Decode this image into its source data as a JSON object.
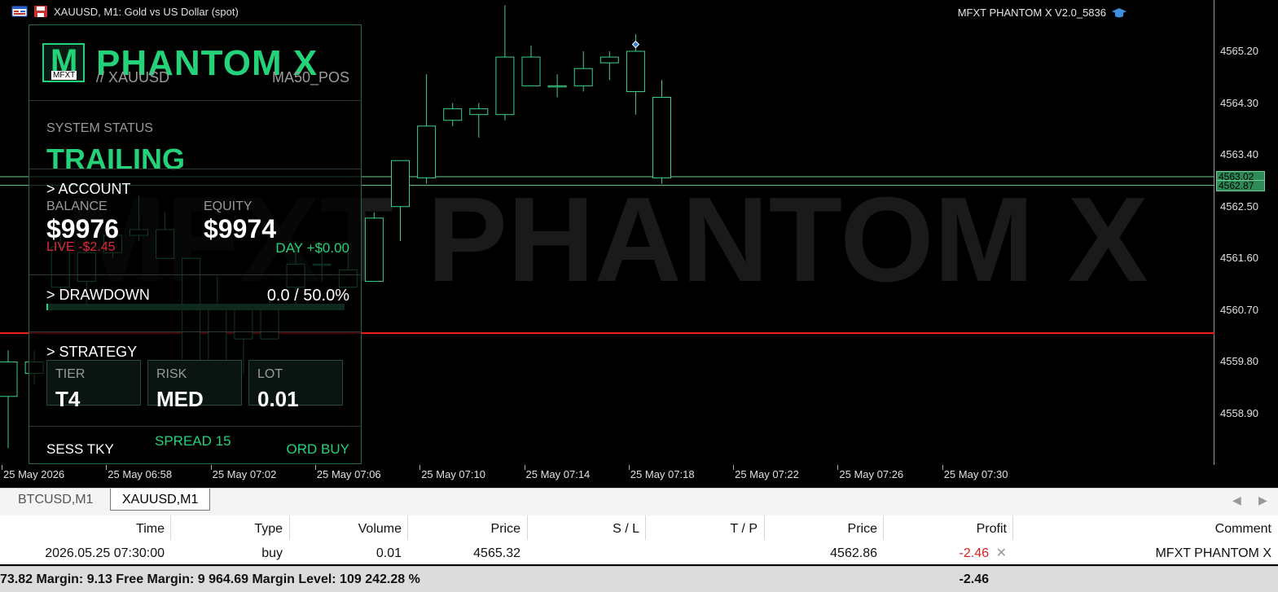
{
  "window": {
    "title": "XAUUSD, M1:  Gold vs US Dollar (spot)",
    "ea_name": "MFXT PHANTOM X V2.0_5836"
  },
  "watermark": "MFXT PHANTOM X",
  "price_axis": {
    "labels": [
      "4565.20",
      "4564.30",
      "4563.40",
      "4562.50",
      "4561.60",
      "4560.70",
      "4559.80",
      "4558.90"
    ],
    "bid_tag": "4563.02",
    "ask_tag": "4562.87"
  },
  "time_axis": {
    "labels": [
      "25 May 2026",
      "25 May 06:58",
      "25 May 07:02",
      "25 May 07:06",
      "25 May 07:10",
      "25 May 07:14",
      "25 May 07:18",
      "25 May 07:22",
      "25 May 07:26",
      "25 May 07:30"
    ]
  },
  "chart_data": {
    "type": "candlestick",
    "symbol": "XAUUSD",
    "timeframe": "M1",
    "ylim": [
      4558.3,
      4566.2
    ],
    "candles": [
      {
        "o": 4559.2,
        "h": 4560.0,
        "l": 4558.3,
        "c": 4559.8
      },
      {
        "o": 4559.6,
        "h": 4560.0,
        "l": 4559.4,
        "c": 4559.8
      },
      {
        "o": 4561.8,
        "h": 4562.1,
        "l": 4561.0,
        "c": 4561.1
      },
      {
        "o": 4561.2,
        "h": 4561.7,
        "l": 4560.8,
        "c": 4561.7
      },
      {
        "o": 4561.7,
        "h": 4562.0,
        "l": 4561.6,
        "c": 4562.0
      },
      {
        "o": 4562.1,
        "h": 4562.7,
        "l": 4561.9,
        "c": 4562.0
      },
      {
        "o": 4562.1,
        "h": 4562.4,
        "l": 4561.6,
        "c": 4561.6
      },
      {
        "o": 4561.6,
        "h": 4561.6,
        "l": 4559.6,
        "c": 4559.6
      },
      {
        "o": 4560.8,
        "h": 4561.3,
        "l": 4559.7,
        "c": 4559.7
      },
      {
        "o": 4560.2,
        "h": 4560.8,
        "l": 4559.6,
        "c": 4560.8
      },
      {
        "o": 4560.2,
        "h": 4560.9,
        "l": 4560.2,
        "c": 4560.8
      },
      {
        "o": 4561.1,
        "h": 4561.9,
        "l": 4560.8,
        "c": 4561.5
      },
      {
        "o": 4561.5,
        "h": 4561.8,
        "l": 4561.2,
        "c": 4561.5
      },
      {
        "o": 4561.1,
        "h": 4561.7,
        "l": 4561.1,
        "c": 4561.4
      },
      {
        "o": 4561.2,
        "h": 4562.4,
        "l": 4561.2,
        "c": 4562.3
      },
      {
        "o": 4562.5,
        "h": 4563.3,
        "l": 4561.9,
        "c": 4563.3
      },
      {
        "o": 4563.0,
        "h": 4564.8,
        "l": 4562.9,
        "c": 4563.9
      },
      {
        "o": 4564.0,
        "h": 4564.3,
        "l": 4563.9,
        "c": 4564.2
      },
      {
        "o": 4564.2,
        "h": 4564.3,
        "l": 4563.7,
        "c": 4564.1
      },
      {
        "o": 4564.1,
        "h": 4566.0,
        "l": 4564.0,
        "c": 4565.1
      },
      {
        "o": 4564.6,
        "h": 4565.3,
        "l": 4564.6,
        "c": 4565.1
      },
      {
        "o": 4564.6,
        "h": 4564.8,
        "l": 4564.4,
        "c": 4564.6
      },
      {
        "o": 4564.6,
        "h": 4565.2,
        "l": 4564.5,
        "c": 4564.9
      },
      {
        "o": 4565.0,
        "h": 4565.2,
        "l": 4564.7,
        "c": 4565.1
      },
      {
        "o": 4565.2,
        "h": 4565.5,
        "l": 4564.1,
        "c": 4564.5
      },
      {
        "o": 4564.4,
        "h": 4564.7,
        "l": 4562.9,
        "c": 4563.0
      }
    ],
    "hlines": [
      {
        "price": 4563.02,
        "color": "#6fcf97"
      },
      {
        "price": 4562.87,
        "color": "#6fcf97"
      },
      {
        "price": 4560.3,
        "color": "#ff2020"
      }
    ]
  },
  "panel": {
    "logo_text": "M",
    "logo_sub": "MFXT",
    "title": "PHANTOM X",
    "symbol": "// XAUUSD",
    "filter": "MA50_POS",
    "status_label": "SYSTEM STATUS",
    "status_value": "TRAILING",
    "account_header": "> ACCOUNT",
    "balance_label": "BALANCE",
    "balance_value": "$9976",
    "equity_label": "EQUITY",
    "equity_value": "$9974",
    "live_pnl": "LIVE -$2.45",
    "day_pnl": "DAY +$0.00",
    "drawdown_header": "> DRAWDOWN",
    "drawdown_value": "0.0 / 50.0%",
    "drawdown_fraction": 0.0,
    "strategy_header": "> STRATEGY",
    "tier_label": "TIER",
    "tier_value": "T4",
    "risk_label": "RISK",
    "risk_value": "MED",
    "lot_label": "LOT",
    "lot_value": "0.01",
    "session": "SESS TKY",
    "spread": "SPREAD 15",
    "order": "ORD BUY"
  },
  "tabs": [
    "BTCUSD,M1",
    "XAUUSD,M1"
  ],
  "active_tab": "XAUUSD,M1",
  "trades": {
    "headers": [
      "Time",
      "Type",
      "Volume",
      "Price",
      "S / L",
      "T / P",
      "Price",
      "Profit",
      "Comment"
    ],
    "rows": [
      {
        "time": "2026.05.25 07:30:00",
        "type": "buy",
        "volume": "0.01",
        "price": "4565.32",
        "sl": "",
        "tp": "",
        "cur_price": "4562.86",
        "profit": "-2.46",
        "comment": "MFXT PHANTOM X"
      }
    ]
  },
  "summary": {
    "text": "73.82  Margin: 9.13  Free Margin: 9 964.69  Margin Level: 109 242.28 %",
    "profit": "-2.46"
  },
  "colors": {
    "bull": "#000000",
    "candle_edge": "#3fd18a",
    "accent": "#23d279",
    "loss": "#e0283a"
  }
}
